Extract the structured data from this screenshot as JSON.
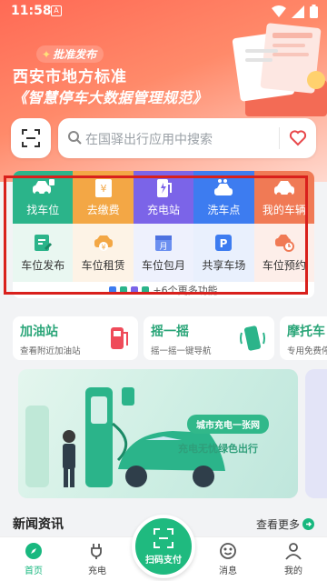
{
  "status": {
    "time": "11:58",
    "a_icon": "A"
  },
  "banner": {
    "badge": "批准发布",
    "title_line1": "西安市地方标准",
    "title_line2": "《智慧停车大数据管理规范》"
  },
  "search": {
    "placeholder": "在国驿出行应用中搜索"
  },
  "services_row1": [
    {
      "label": "找车位",
      "color": "#2bb48a",
      "icon": "car-icon"
    },
    {
      "label": "去缴费",
      "color": "#f3a745",
      "icon": "yuan-ticket-icon"
    },
    {
      "label": "充电站",
      "color": "#7b64e8",
      "icon": "charging-pump-icon"
    },
    {
      "label": "洗车点",
      "color": "#3d7cf0",
      "icon": "car-wash-icon"
    },
    {
      "label": "我的车辆",
      "color": "#f07a55",
      "icon": "my-car-icon"
    }
  ],
  "services_row2": [
    {
      "label": "车位发布",
      "icon": "publish-icon",
      "color": "#2bb48a"
    },
    {
      "label": "车位租赁",
      "icon": "lease-icon",
      "color": "#f3a745"
    },
    {
      "label": "车位包月",
      "icon": "calendar-icon",
      "color": "#6b8ff0"
    },
    {
      "label": "共享车场",
      "icon": "parking-p-icon",
      "color": "#3d7cf0"
    },
    {
      "label": "车位预约",
      "icon": "reserve-icon",
      "color": "#f07a55"
    }
  ],
  "more_functions": "+6个更多功能",
  "features": [
    {
      "title": "加油站",
      "sub": "查看附近加油站",
      "color": "#2aa578"
    },
    {
      "title": "摇一摇",
      "sub": "摇一摇一键导航",
      "color": "#2aa578"
    },
    {
      "title": "摩托车",
      "sub": "专用免费停",
      "color": "#2aa578"
    }
  ],
  "promo": {
    "pill": "城市充电一张网",
    "slogan": "充电无忧绿色出行"
  },
  "news": {
    "title": "新闻资讯",
    "more": "查看更多"
  },
  "tabs": [
    {
      "label": "首页"
    },
    {
      "label": "充电"
    },
    {
      "label": "扫码支付"
    },
    {
      "label": "消息"
    },
    {
      "label": "我的"
    }
  ]
}
